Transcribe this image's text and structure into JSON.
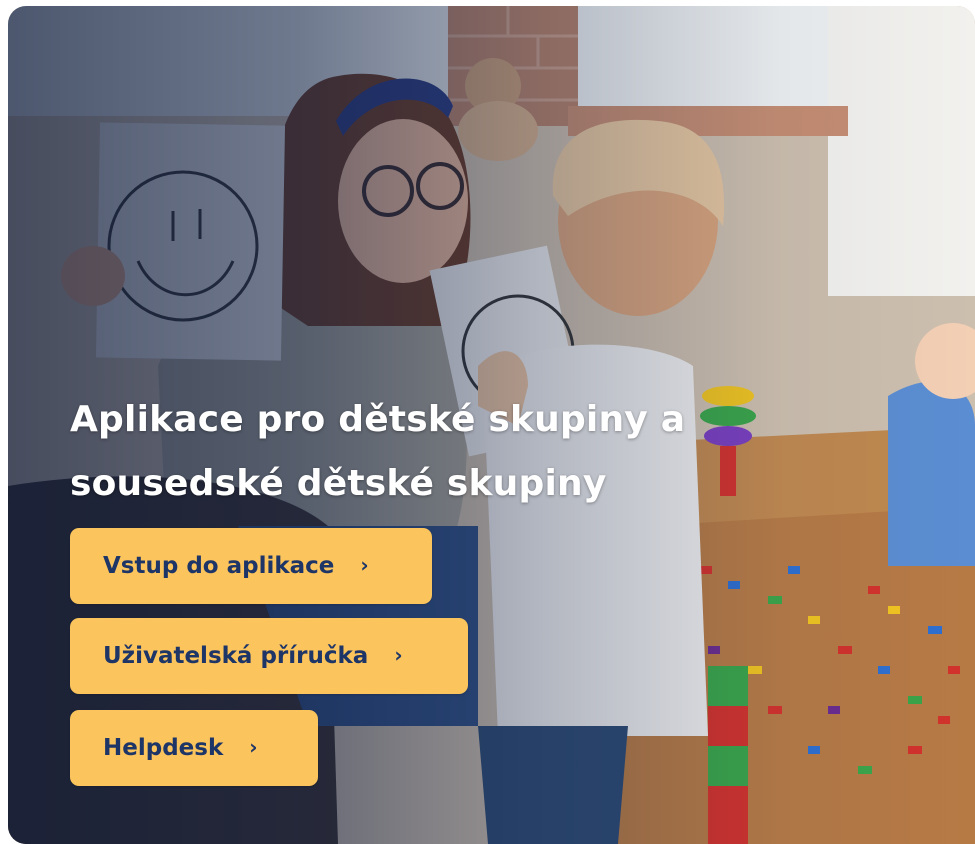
{
  "hero": {
    "title": "Aplikace pro dětské skupiny a sousedské dětské skupiny",
    "image_description_icon": "classroom-photo"
  },
  "buttons": {
    "app_label": "Vstup do aplikace",
    "manual_label": "Uživatelská příručka",
    "helpdesk_label": "Helpdesk",
    "chevron": "›"
  },
  "colors": {
    "button_bg": "#fbc45c",
    "button_text": "#1e3567",
    "overlay": "#0e1c3c",
    "title": "#ffffff"
  }
}
